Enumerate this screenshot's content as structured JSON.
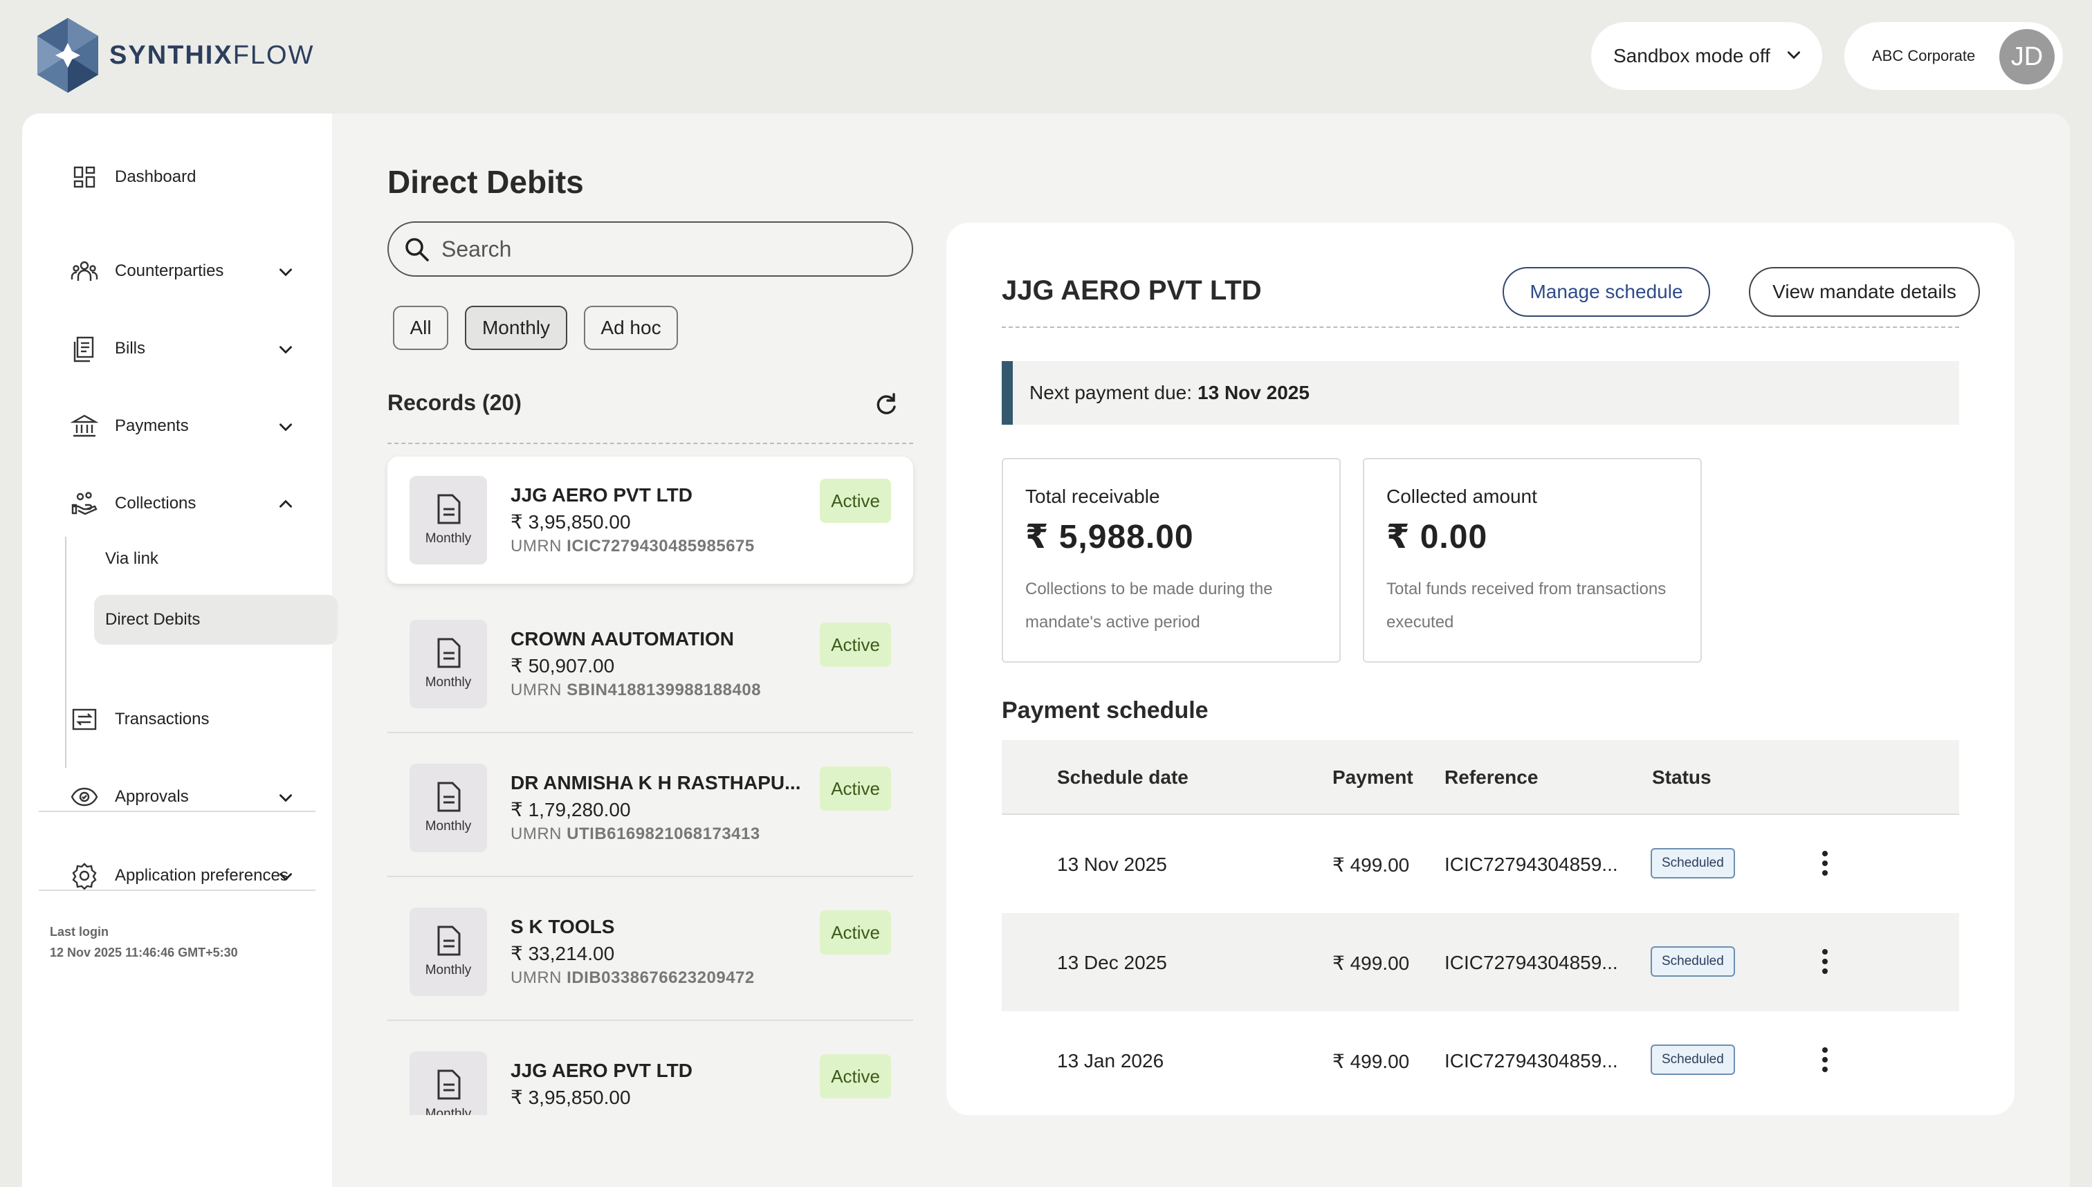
{
  "app": {
    "logo_bold": "SYNTHIX",
    "logo_light": "FLOW",
    "sandbox_label": "Sandbox mode off",
    "account_name": "ABC Corporate",
    "avatar_initials": "JD"
  },
  "sidebar": {
    "items": [
      {
        "label": "Dashboard",
        "icon": "dashboard-icon"
      },
      {
        "label": "Counterparties",
        "icon": "people-icon",
        "expandable": true
      },
      {
        "label": "Bills",
        "icon": "bill-icon",
        "expandable": true
      },
      {
        "label": "Payments",
        "icon": "bank-icon",
        "expandable": true
      },
      {
        "label": "Collections",
        "icon": "collections-icon",
        "expanded": true
      },
      {
        "label": "Transactions",
        "icon": "transfer-icon"
      },
      {
        "label": "Approvals",
        "icon": "eye-icon",
        "expandable": true
      },
      {
        "label": "Application preferences",
        "icon": "settings-icon",
        "expandable": true
      }
    ],
    "collections_sub": [
      {
        "label": "Via link"
      },
      {
        "label": "Direct Debits",
        "active": true
      }
    ],
    "last_login_label": "Last login",
    "last_login_value": "12 Nov 2025 11:46:46 GMT+5:30"
  },
  "list": {
    "title": "Direct Debits",
    "search_placeholder": "Search",
    "filters": [
      "All",
      "Monthly",
      "Ad hoc"
    ],
    "active_filter": "Monthly",
    "records_title": "Records (20)",
    "umrn_prefix": "UMRN",
    "records": [
      {
        "name": "JJG AERO PVT LTD",
        "amount": "₹ 3,95,850.00",
        "umrn": "ICIC7279430485985675",
        "frequency": "Monthly",
        "status": "Active",
        "selected": true
      },
      {
        "name": "CROWN AAUTOMATION",
        "amount": "₹ 50,907.00",
        "umrn": "SBIN4188139988188408",
        "frequency": "Monthly",
        "status": "Active"
      },
      {
        "name": "DR ANMISHA K H RASTHAPU...",
        "amount": "₹ 1,79,280.00",
        "umrn": "UTIB6169821068173413",
        "frequency": "Monthly",
        "status": "Active"
      },
      {
        "name": "S K TOOLS",
        "amount": "₹ 33,214.00",
        "umrn": "IDIB0338676623209472",
        "frequency": "Monthly",
        "status": "Active"
      },
      {
        "name": "JJG AERO PVT LTD",
        "amount": "₹ 3,95,850.00",
        "umrn": "",
        "frequency": "Monthly",
        "status": "Active"
      }
    ]
  },
  "detail": {
    "title": "JJG AERO PVT LTD",
    "manage_button": "Manage schedule",
    "view_button": "View mandate details",
    "next_due_label": "Next payment due:",
    "next_due_value": "13 Nov 2025",
    "total_receivable": {
      "label": "Total receivable",
      "value": "₹ 5,988.00",
      "desc": "Collections to be made during the mandate's active period"
    },
    "collected_amount": {
      "label": "Collected amount",
      "value": "₹ 0.00",
      "desc": "Total funds received from transactions executed"
    },
    "schedule_title": "Payment schedule",
    "columns": [
      "Schedule date",
      "Payment",
      "Reference",
      "Status"
    ],
    "rows": [
      {
        "date": "13 Nov 2025",
        "payment": "₹ 499.00",
        "reference": "ICIC72794304859...",
        "status": "Scheduled"
      },
      {
        "date": "13 Dec 2025",
        "payment": "₹ 499.00",
        "reference": "ICIC72794304859...",
        "status": "Scheduled"
      },
      {
        "date": "13 Jan 2026",
        "payment": "₹ 499.00",
        "reference": "ICIC72794304859...",
        "status": "Scheduled"
      }
    ]
  },
  "colors": {
    "accent": "#34596e",
    "active_badge": "#dff3c8",
    "scheduled_badge": "#e9f1f9"
  }
}
